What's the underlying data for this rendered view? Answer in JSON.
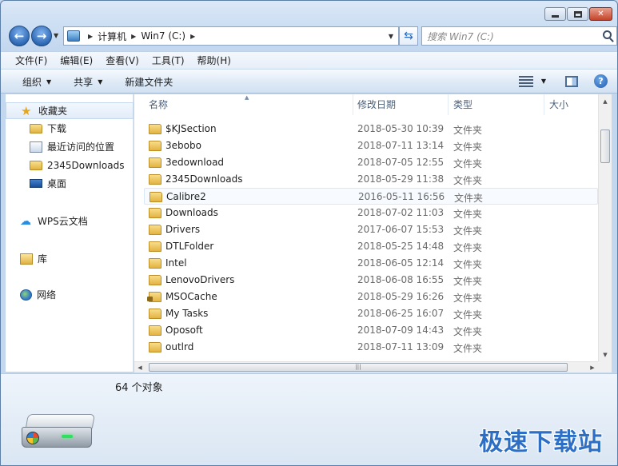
{
  "window": {
    "caption_buttons": [
      "minimize",
      "maximize",
      "close"
    ]
  },
  "navigation": {
    "breadcrumbs": [
      "计算机",
      "Win7 (C:)"
    ],
    "search_placeholder": "搜索 Win7 (C:)"
  },
  "menu": [
    "文件(F)",
    "编辑(E)",
    "查看(V)",
    "工具(T)",
    "帮助(H)"
  ],
  "toolbar": {
    "organize": "组织",
    "share": "共享",
    "new_folder": "新建文件夹"
  },
  "sidebar": {
    "favorites": {
      "label": "收藏夹",
      "items": [
        {
          "label": "下载",
          "icon": "folder-icon"
        },
        {
          "label": "最近访问的位置",
          "icon": "recent-places-icon"
        },
        {
          "label": "2345Downloads",
          "icon": "folder-icon"
        },
        {
          "label": "桌面",
          "icon": "desktop-icon"
        }
      ]
    },
    "wps_cloud": "WPS云文档",
    "libraries": "库",
    "network": "网络"
  },
  "columns": [
    "名称",
    "修改日期",
    "类型",
    "大小"
  ],
  "files": [
    {
      "name": "$KJSection",
      "date": "2018-05-30 10:39",
      "type": "文件夹"
    },
    {
      "name": "3ebobo",
      "date": "2018-07-11 13:14",
      "type": "文件夹"
    },
    {
      "name": "3edownload",
      "date": "2018-07-05 12:55",
      "type": "文件夹"
    },
    {
      "name": "2345Downloads",
      "date": "2018-05-29 11:38",
      "type": "文件夹"
    },
    {
      "name": "Calibre2",
      "date": "2016-05-11 16:56",
      "type": "文件夹"
    },
    {
      "name": "Downloads",
      "date": "2018-07-02 11:03",
      "type": "文件夹"
    },
    {
      "name": "Drivers",
      "date": "2017-06-07 15:53",
      "type": "文件夹"
    },
    {
      "name": "DTLFolder",
      "date": "2018-05-25 14:48",
      "type": "文件夹"
    },
    {
      "name": "Intel",
      "date": "2018-06-05 12:14",
      "type": "文件夹"
    },
    {
      "name": "LenovoDrivers",
      "date": "2018-06-08 16:55",
      "type": "文件夹"
    },
    {
      "name": "MSOCache",
      "date": "2018-05-29 16:26",
      "type": "文件夹"
    },
    {
      "name": "My Tasks",
      "date": "2018-06-25 16:07",
      "type": "文件夹"
    },
    {
      "name": "Oposoft",
      "date": "2018-07-09 14:43",
      "type": "文件夹"
    },
    {
      "name": "outlrd",
      "date": "2018-07-11 13:09",
      "type": "文件夹"
    }
  ],
  "status": {
    "count": "64 个对象"
  },
  "watermark": "极速下载站"
}
